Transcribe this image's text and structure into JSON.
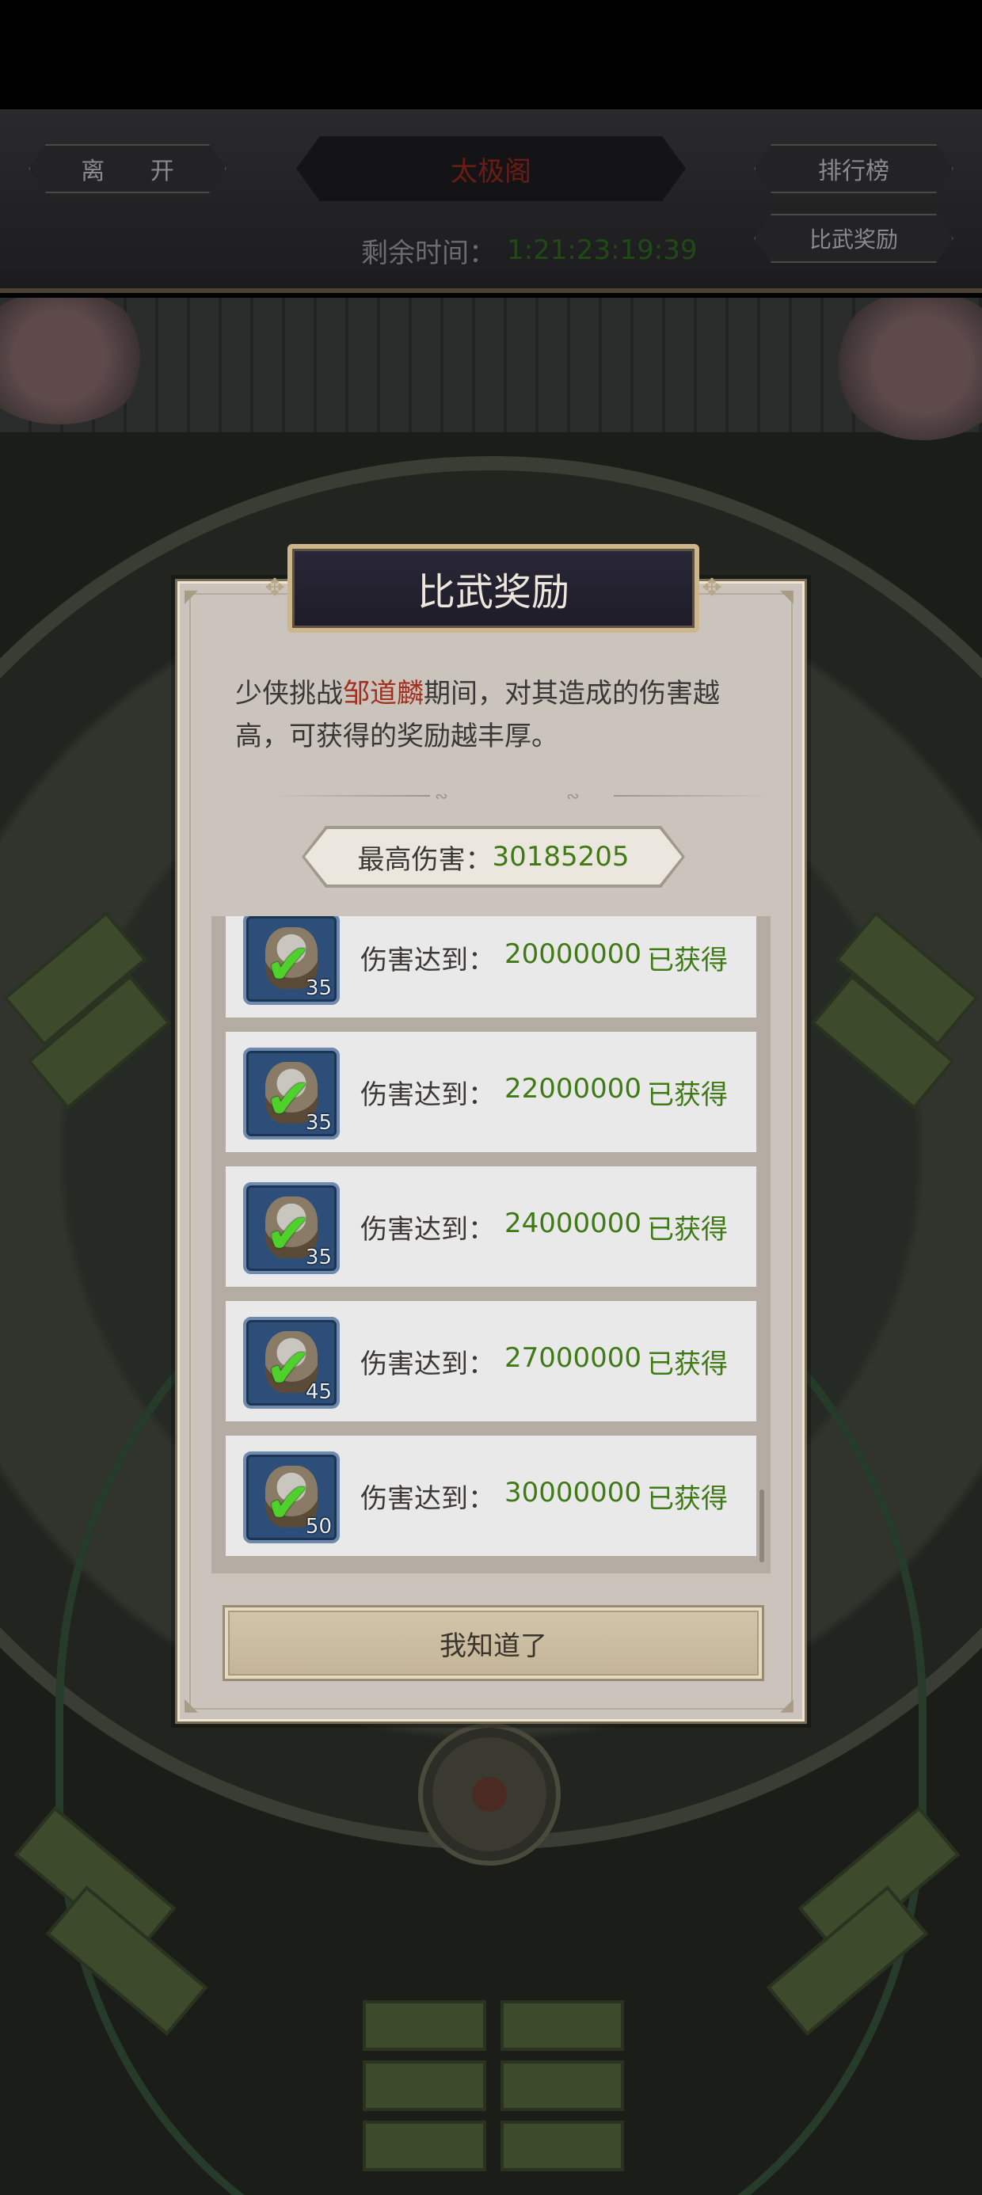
{
  "header": {
    "leave_label": "离 开",
    "title": "太极阁",
    "rank_label": "排行榜",
    "reward_label": "比武奖励",
    "time_label": "剩余时间：",
    "time_value": "1:21:23:19:39"
  },
  "modal": {
    "title": "比武奖励",
    "desc_prefix": "少侠挑战",
    "boss_name": "邹道麟",
    "desc_suffix": "期间，对其造成的伤害越高，可获得的奖励越丰厚。",
    "max_damage_label": "最高伤害：",
    "max_damage_value": "30185205",
    "rewards": [
      {
        "label": "伤害达到：",
        "threshold": "20000000",
        "status": "已获得",
        "count": "35",
        "icon": "reward-bag-icon"
      },
      {
        "label": "伤害达到：",
        "threshold": "22000000",
        "status": "已获得",
        "count": "35",
        "icon": "reward-bag-icon"
      },
      {
        "label": "伤害达到：",
        "threshold": "24000000",
        "status": "已获得",
        "count": "35",
        "icon": "reward-bag-icon"
      },
      {
        "label": "伤害达到：",
        "threshold": "27000000",
        "status": "已获得",
        "count": "45",
        "icon": "reward-bag-icon"
      },
      {
        "label": "伤害达到：",
        "threshold": "30000000",
        "status": "已获得",
        "count": "50",
        "icon": "reward-bag-icon"
      }
    ],
    "ok_label": "我知道了"
  },
  "colors": {
    "accent_green": "#3f7a17",
    "boss_red": "#a0301f",
    "title_red": "#6a1c14",
    "check_green": "#4fd12b"
  }
}
